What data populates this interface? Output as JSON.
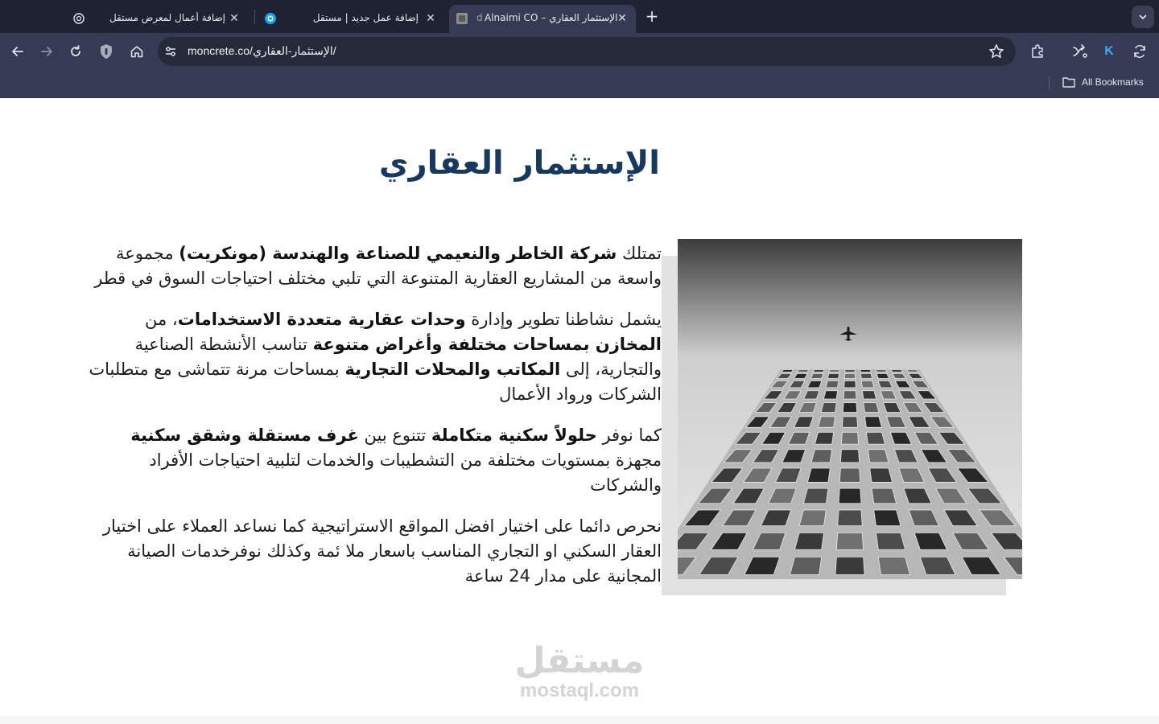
{
  "browser": {
    "tabs": [
      {
        "title": "إضافة أعمال لمعرض مستقل",
        "favicon": "openai-icon",
        "active": false
      },
      {
        "title": "إضافة عمل جديد | مستقل",
        "favicon": "mostaql-icon",
        "active": false
      },
      {
        "title": "Alnaimi CO – الإستثمار العقاري",
        "favicon": "site-icon",
        "active": true
      }
    ],
    "active_tab_prefix": "d",
    "new_tab_label": "+",
    "url": "moncrete.co/الإستثمار-العقاري/",
    "bookmarks_label": "All Bookmarks",
    "close_glyph": "✕"
  },
  "page": {
    "title": "الإستثمار العقاري",
    "paragraphs": [
      {
        "p1": "تمتلك ",
        "b1": "شركة الخاطر والنعيمي للصناعة والهندسة (مونكريت)",
        "p2": " مجموعة واسعة من المشاريع العقارية المتنوعة التي تلبي مختلف احتياجات السوق في قطر"
      },
      {
        "p1": "يشمل نشاطنا تطوير وإدارة ",
        "b1": "وحدات عقارية متعددة الاستخدامات",
        "p2": "، من ",
        "b2": "المخازن بمساحات مختلفة وأغراض متنوعة",
        "p3": " تناسب الأنشطة الصناعية والتجارية، إلى ",
        "b3": "المكاتب والمحلات التجارية",
        "p4": " بمساحات مرنة تتماشى مع متطلبات الشركات ورواد الأعمال"
      },
      {
        "p1": "كما نوفر ",
        "b1": "حلولاً سكنية متكاملة",
        "p2": " تتنوع بين ",
        "b2": "غرف مستقلة وشقق سكنية",
        "p3": " مجهزة بمستويات مختلفة من التشطيبات والخدمات لتلبية احتياجات الأفراد والشركات"
      },
      {
        "p1": "نحرص دائما على اختيار افضل المواقع الاستراتيجية كما نساعد العملاء على اختيار العقار السكني او التجاري المناسب باسعار ملا ئمة وكذلك نوفرخدمات الصيانة المجانية على مدار 24 ساعة"
      }
    ],
    "watermark": {
      "arabic": "مستقل",
      "latin": "mostaql.com"
    }
  },
  "colors": {
    "title": "#17395f",
    "chrome_bg": "#353b53",
    "tabstrip_bg": "#1f2233",
    "omnibox_bg": "#252939"
  }
}
